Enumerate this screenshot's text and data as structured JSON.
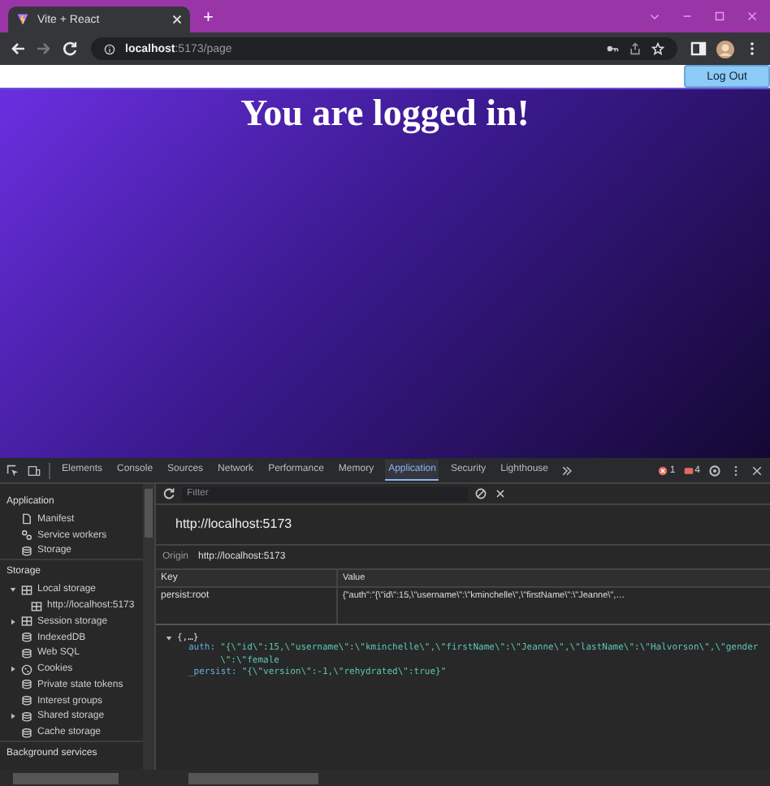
{
  "browser": {
    "tab_title": "Vite + React",
    "new_tab": "+",
    "url_host": "localhost",
    "url_path": ":5173/page"
  },
  "page": {
    "logout_button": "Log Out",
    "heading": "You are logged in!"
  },
  "devtools": {
    "tabs": [
      {
        "label": "Elements",
        "selected": false
      },
      {
        "label": "Console",
        "selected": false
      },
      {
        "label": "Sources",
        "selected": false
      },
      {
        "label": "Network",
        "selected": false
      },
      {
        "label": "Performance",
        "selected": false
      },
      {
        "label": "Memory",
        "selected": false
      },
      {
        "label": "Application",
        "selected": true
      },
      {
        "label": "Security",
        "selected": false
      },
      {
        "label": "Lighthouse",
        "selected": false
      }
    ],
    "error_count": "1",
    "warning_count": "4",
    "sidebar": {
      "sections": [
        {
          "title": "Application",
          "items": [
            {
              "label": "Manifest",
              "kind": "file"
            },
            {
              "label": "Service workers",
              "kind": "worker"
            },
            {
              "label": "Storage",
              "kind": "database"
            }
          ]
        },
        {
          "title": "Storage",
          "items": [
            {
              "label": "Local storage",
              "kind": "table",
              "expanded": true,
              "children": [
                {
                  "label": "http://localhost:5173"
                }
              ]
            },
            {
              "label": "Session storage",
              "kind": "table",
              "expanded": false
            },
            {
              "label": "IndexedDB",
              "kind": "database"
            },
            {
              "label": "Web SQL",
              "kind": "database"
            },
            {
              "label": "Cookies",
              "kind": "cookie",
              "expanded": false
            },
            {
              "label": "Private state tokens",
              "kind": "database"
            },
            {
              "label": "Interest groups",
              "kind": "database"
            },
            {
              "label": "Shared storage",
              "kind": "database",
              "expanded": false
            },
            {
              "label": "Cache storage",
              "kind": "database"
            }
          ]
        },
        {
          "title": "Background services"
        }
      ]
    },
    "filter": {
      "placeholder": "Filter"
    },
    "origin_title": "http://localhost:5173",
    "origin_label": "Origin",
    "origin_value": "http://localhost:5173",
    "table": {
      "columns": [
        "Key",
        "Value"
      ],
      "rows": [
        {
          "key": "persist:root",
          "value": "{\"auth\":\"{\\\"id\\\":15,\\\"username\\\":\\\"kminchelle\\\",\\\"firstName\\\":\\\"Jeanne\\\",…"
        }
      ]
    },
    "preview": {
      "summary": "{,…}",
      "entries": [
        {
          "key": "auth:",
          "value": "\"{\\\"id\\\":15,\\\"username\\\":\\\"kminchelle\\\",\\\"firstName\\\":\\\"Jeanne\\\",\\\"lastName\\\":\\\"Halvorson\\\",\\\"gender\\\":\\\"female"
        },
        {
          "key": "_persist:",
          "value": "\"{\\\"version\\\":-1,\\\"rehydrated\\\":true}\""
        }
      ]
    }
  }
}
